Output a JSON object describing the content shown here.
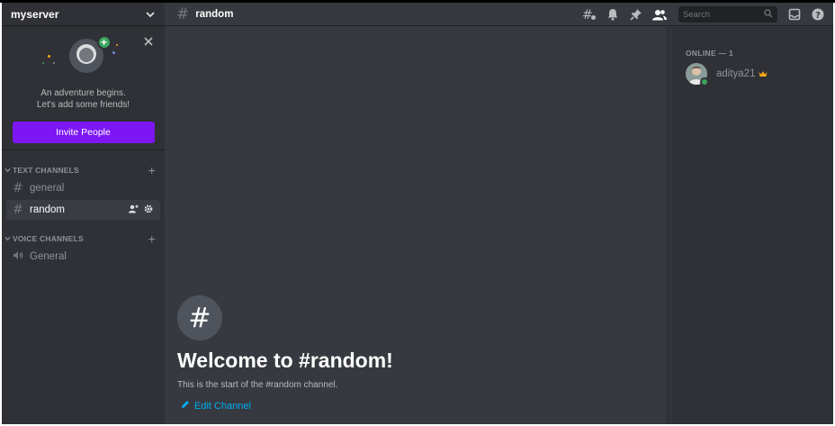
{
  "server": {
    "name": "myserver"
  },
  "invite_card": {
    "line1": "An adventure begins.",
    "line2": "Let's add some friends!",
    "button_label": "Invite People"
  },
  "categories": {
    "text": {
      "label": "TEXT CHANNELS"
    },
    "voice": {
      "label": "VOICE CHANNELS"
    }
  },
  "channels": {
    "text": [
      {
        "name": "general",
        "active": false
      },
      {
        "name": "random",
        "active": true
      }
    ],
    "voice": [
      {
        "name": "General"
      }
    ]
  },
  "header": {
    "channel": "random",
    "search_placeholder": "Search"
  },
  "welcome": {
    "title": "Welcome to #random!",
    "subtitle": "This is the start of the #random channel.",
    "edit_label": "Edit Channel"
  },
  "members": {
    "category_label": "ONLINE — 1",
    "list": [
      {
        "name": "aditya21",
        "status": "online",
        "owner": true
      }
    ]
  },
  "colors": {
    "invite_button": "#7c16f5",
    "online": "#3ba55c",
    "link": "#00aff4",
    "crown": "#faa61a"
  }
}
